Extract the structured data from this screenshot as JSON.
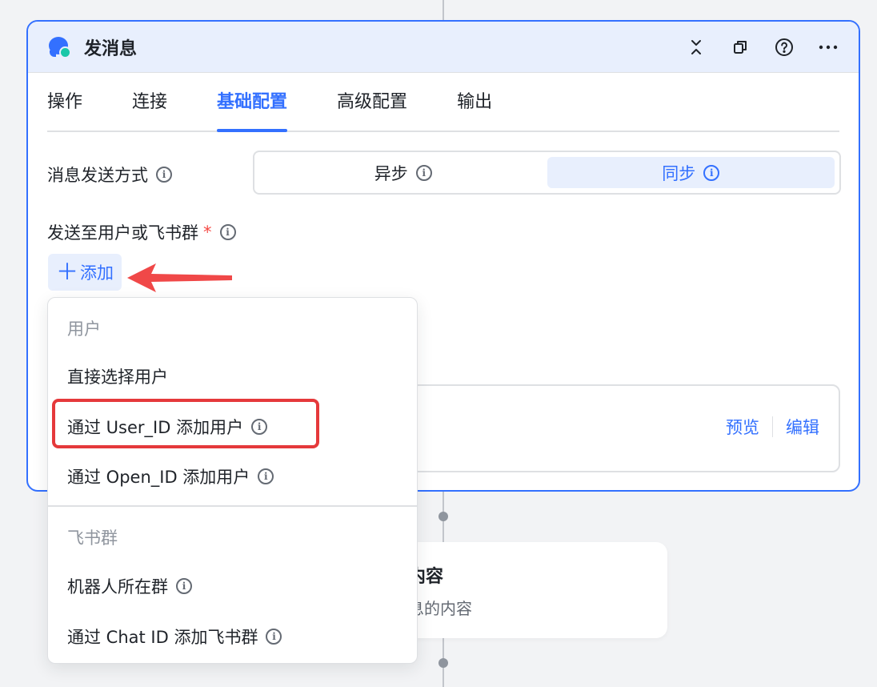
{
  "node": {
    "title": "发消息"
  },
  "tabs": [
    "操作",
    "连接",
    "基础配置",
    "高级配置",
    "输出"
  ],
  "active_tab": 2,
  "send_mode": {
    "label": "消息发送方式",
    "options": [
      "异步",
      "同步"
    ],
    "selected": 1
  },
  "recipients": {
    "label": "发送至用户或飞书群",
    "required_mark": "*",
    "add_button": "添加",
    "add_plus": "＋"
  },
  "content_box": {
    "preview": "预览",
    "edit": "编辑"
  },
  "next_node": {
    "title_fragment": "内容",
    "subtitle_fragment": "息的内容"
  },
  "dropdown": {
    "group_user": "用户",
    "item_direct": "直接选择用户",
    "item_user_id": "通过 User_ID 添加用户",
    "item_open_id": "通过 Open_ID 添加用户",
    "group_chat": "飞书群",
    "item_bot_group": "机器人所在群",
    "item_chat_id": "通过 Chat ID 添加飞书群"
  },
  "colors": {
    "accent": "#3370ff",
    "highlight_box": "#e5393b",
    "arrow": "#f04848"
  }
}
